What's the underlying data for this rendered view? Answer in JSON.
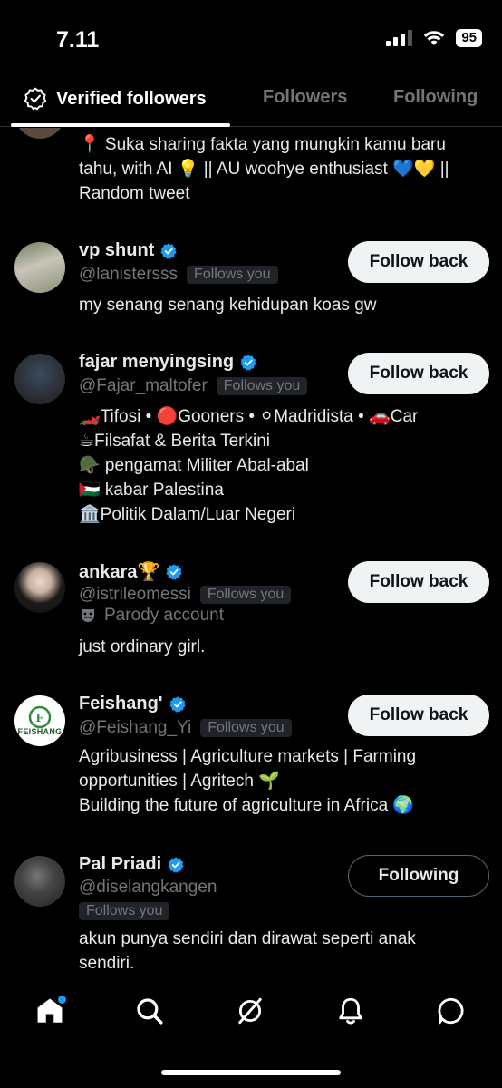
{
  "status_bar": {
    "time": "7.11",
    "battery": "95"
  },
  "tabs": [
    {
      "label": "Verified followers",
      "active": true
    },
    {
      "label": "Followers",
      "active": false
    },
    {
      "label": "Following",
      "active": false
    }
  ],
  "partial_user": {
    "bio": [
      "📍 Suka sharing fakta yang mungkin kamu baru",
      "tahu, with AI 💡 || AU woohye enthusiast 💙💛 ||",
      "Random tweet"
    ]
  },
  "users": [
    {
      "name": "vp shunt",
      "handle": "@lanistersss",
      "follows_you": "Follows you",
      "button": "Follow back",
      "bio": [
        "my senang senang kehidupan koas gw"
      ]
    },
    {
      "name": "fajar menyingsing",
      "handle": "@Fajar_maltofer",
      "follows_you": "Follows you",
      "button": "Follow back",
      "bio": [
        "🏎️Tifosi • 🔴Gooners • ⚪Madridista • 🚗Car",
        "☕Filsafat & Berita Terkini",
        "🪖 pengamat Militer Abal-abal",
        "🇵🇸 kabar Palestina",
        "🏛️Politik Dalam/Luar Negeri"
      ]
    },
    {
      "name": "ankara🏆",
      "handle": "@istrileomessi",
      "follows_you": "Follows you",
      "button": "Follow back",
      "parody": "Parody account",
      "bio": [
        "just ordinary girl."
      ]
    },
    {
      "name": "Feishang'",
      "handle": "@Feishang_Yi",
      "follows_you": "Follows you",
      "button": "Follow back",
      "avatar_text": "FEISHANG",
      "bio": [
        "Agribusiness | Agriculture markets | Farming",
        "opportunities | Agritech 🌱",
        "Building the future of agriculture in Africa 🌍"
      ]
    },
    {
      "name": "Pal Priadi",
      "handle": "@diselangkangen",
      "follows_you": "Follows you",
      "button": "Following",
      "bio": [
        "akun punya sendiri dan dirawat seperti anak",
        "sendiri."
      ]
    }
  ],
  "nav": [
    "home-icon",
    "search-icon",
    "grok-icon",
    "notifications-icon",
    "messages-icon"
  ],
  "colors": {
    "accent": "#1d9bf0",
    "background": "#000000",
    "muted": "#71767b"
  }
}
